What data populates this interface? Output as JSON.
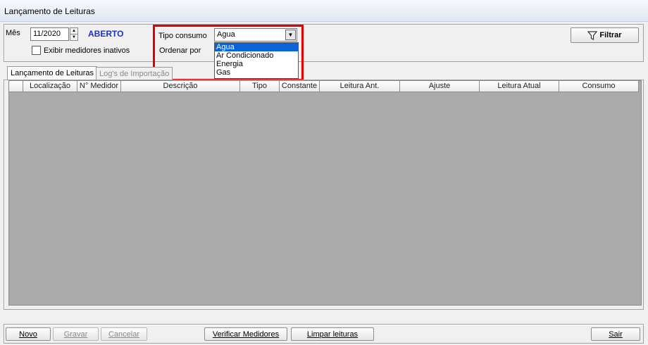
{
  "window": {
    "title": "Lançamento de Leituras"
  },
  "filters": {
    "mes_label": "Mês",
    "mes_value": "11/2020",
    "status": "ABERTO",
    "show_inactive_label": "Exibir medidores inativos",
    "tipo_consumo_label": "Tipo consumo",
    "tipo_consumo_value": "Agua",
    "ordenar_label": "Ordenar por",
    "filter_button": "Filtrar",
    "tipo_options": [
      "Agua",
      "Ar Condicionado",
      "Energia",
      "Gas"
    ]
  },
  "tabs": [
    {
      "label": "Lançamento de Leituras"
    },
    {
      "label": "Log's de Importação"
    }
  ],
  "grid": {
    "columns": [
      "Localização",
      "N° Medidor",
      "Descrição",
      "Tipo",
      "Constante",
      "Leitura Ant.",
      "Ajuste",
      "Leitura Atual",
      "Consumo"
    ]
  },
  "buttons": {
    "novo": "Novo",
    "gravar": "Gravar",
    "cancelar": "Cancelar",
    "verificar": "Verificar Medidores",
    "limpar": "Limpar leituras",
    "sair": "Sair"
  },
  "colors": {
    "status_blue": "#1f2fcf",
    "highlight_red": "#e00000",
    "selection_blue": "#0a64d8",
    "grid_gray": "#ababab"
  }
}
